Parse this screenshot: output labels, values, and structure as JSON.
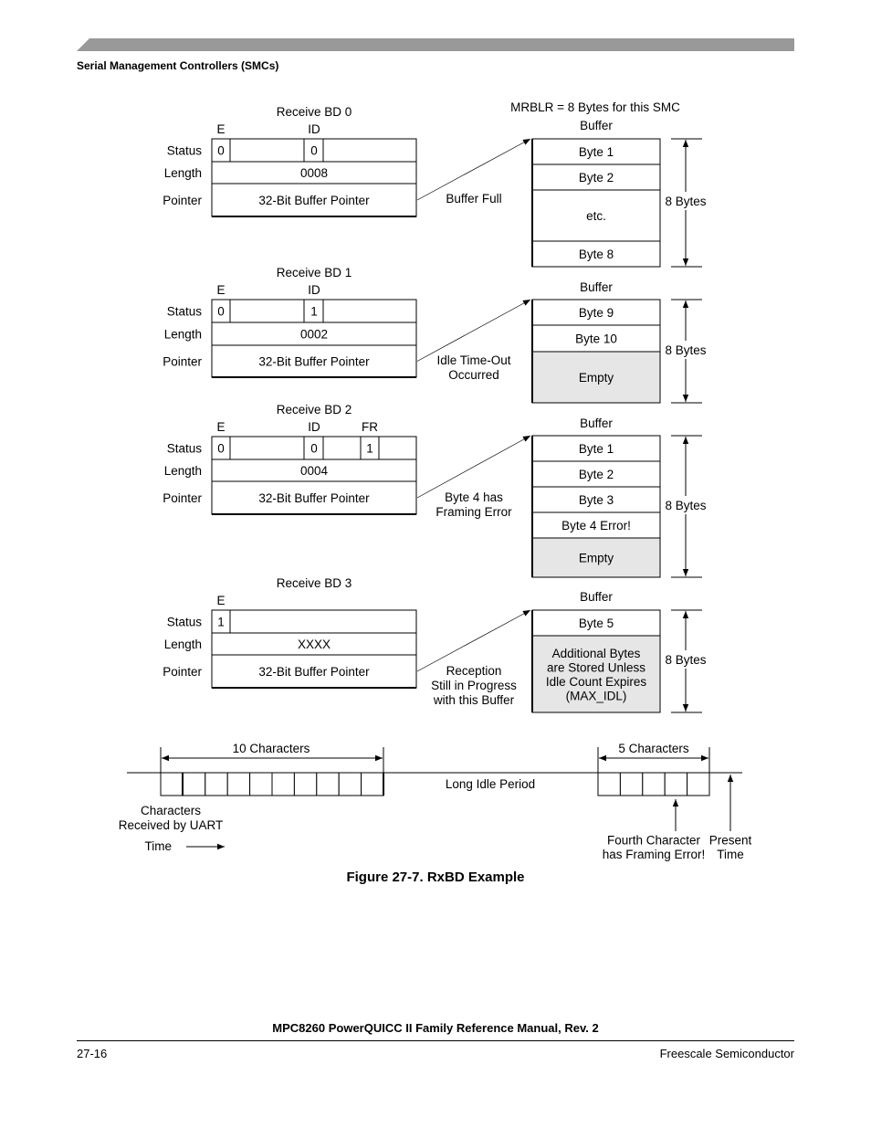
{
  "header": {
    "section_title": "Serial Management Controllers (SMCs)"
  },
  "figure": {
    "caption": "Figure 27-7. RxBD Example",
    "mrblr_note": "MRBLR = 8 Bytes for this SMC",
    "row_labels": {
      "status": "Status",
      "length": "Length",
      "pointer": "Pointer"
    },
    "pointer_text": "32-Bit Buffer Pointer",
    "buffer_title": "Buffer",
    "size_label": "8 Bytes",
    "bds": [
      {
        "title": "Receive BD 0",
        "bit_labels": {
          "e": "E",
          "id": "ID"
        },
        "status": {
          "e": "0",
          "id": "0"
        },
        "length": "0008",
        "event": [
          "Buffer Full"
        ],
        "buffer": [
          {
            "text": [
              "Byte 1"
            ],
            "empty": false
          },
          {
            "text": [
              "Byte 2"
            ],
            "empty": false
          },
          {
            "text": [
              "etc."
            ],
            "empty": false
          },
          {
            "text": [
              "Byte 8"
            ],
            "empty": false
          }
        ]
      },
      {
        "title": "Receive BD 1",
        "bit_labels": {
          "e": "E",
          "id": "ID"
        },
        "status": {
          "e": "0",
          "id": "1"
        },
        "length": "0002",
        "event": [
          "Idle Time-Out",
          "Occurred"
        ],
        "buffer": [
          {
            "text": [
              "Byte 9"
            ],
            "empty": false
          },
          {
            "text": [
              "Byte 10"
            ],
            "empty": false
          },
          {
            "text": [
              "Empty"
            ],
            "empty": true
          }
        ]
      },
      {
        "title": "Receive BD 2",
        "bit_labels": {
          "e": "E",
          "id": "ID",
          "fr": "FR"
        },
        "status": {
          "e": "0",
          "id": "0",
          "fr": "1"
        },
        "length": "0004",
        "event": [
          "Byte 4 has",
          "Framing Error"
        ],
        "buffer": [
          {
            "text": [
              "Byte 1"
            ],
            "empty": false
          },
          {
            "text": [
              "Byte 2"
            ],
            "empty": false
          },
          {
            "text": [
              "Byte 3"
            ],
            "empty": false
          },
          {
            "text": [
              "Byte 4 Error!"
            ],
            "empty": false
          },
          {
            "text": [
              "Empty"
            ],
            "empty": true
          }
        ]
      },
      {
        "title": "Receive BD 3",
        "bit_labels": {
          "e": "E"
        },
        "status": {
          "e": "1"
        },
        "length": "XXXX",
        "event": [
          "Reception",
          "Still in Progress",
          "with this Buffer"
        ],
        "buffer": [
          {
            "text": [
              "Byte 5"
            ],
            "empty": false
          },
          {
            "text": [
              "Additional Bytes",
              "are Stored Unless",
              "Idle Count Expires",
              "(MAX_IDL)"
            ],
            "empty": true
          }
        ]
      }
    ],
    "timeline": {
      "group1_label": "10 Characters",
      "group1_count": 10,
      "idle_label": "Long Idle Period",
      "group2_label": "5 Characters",
      "group2_count": 5,
      "received_label": [
        "Characters",
        "Received by UART"
      ],
      "time_label": "Time",
      "error_label": [
        "Fourth Character",
        "has Framing Error!"
      ],
      "present_label": [
        "Present",
        "Time"
      ]
    }
  },
  "footer": {
    "manual_title": "MPC8260 PowerQUICC II Family Reference Manual, Rev. 2",
    "page_number": "27-16",
    "company": "Freescale Semiconductor"
  },
  "colors": {
    "header_bar": "#999999",
    "empty_fill": "#e6e6e6"
  }
}
